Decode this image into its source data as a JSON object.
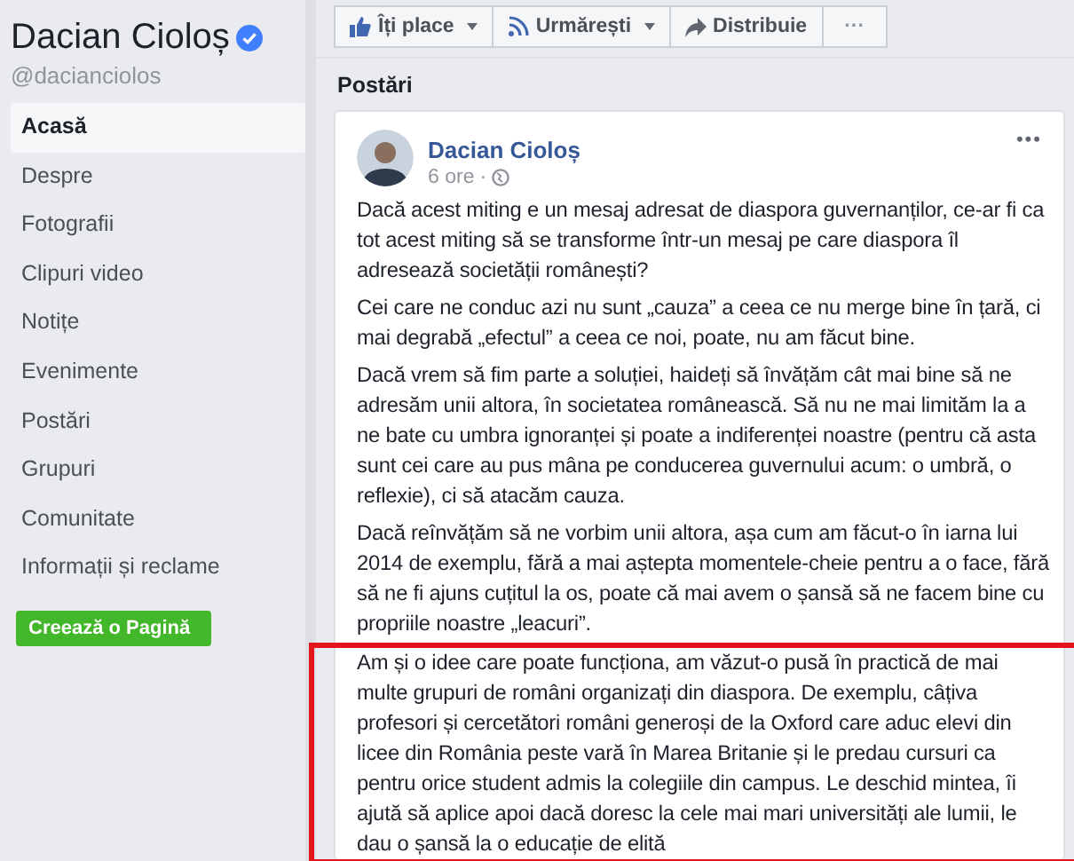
{
  "sidebar": {
    "page_name": "Dacian Cioloș",
    "verified": true,
    "handle": "@dacianciolos",
    "items": [
      {
        "label": "Acasă",
        "selected": true
      },
      {
        "label": "Despre",
        "selected": false
      },
      {
        "label": "Fotografii",
        "selected": false
      },
      {
        "label": "Clipuri video",
        "selected": false
      },
      {
        "label": "Notițe",
        "selected": false
      },
      {
        "label": "Evenimente",
        "selected": false
      },
      {
        "label": "Postări",
        "selected": false
      },
      {
        "label": "Grupuri",
        "selected": false
      },
      {
        "label": "Comunitate",
        "selected": false
      },
      {
        "label": "Informații și reclame",
        "selected": false
      }
    ],
    "create_button": "Creează o Pagină"
  },
  "actions": [
    {
      "kind": "like",
      "label": "Îți place",
      "dropdown": true
    },
    {
      "kind": "follow",
      "label": "Urmărești",
      "dropdown": true
    },
    {
      "kind": "share",
      "label": "Distribuie",
      "dropdown": false
    },
    {
      "kind": "more",
      "label": "···",
      "dropdown": false
    }
  ],
  "section_title": "Postări",
  "post": {
    "author": "Dacian Cioloș",
    "time": "6 ore",
    "separator": "·",
    "menu": "•••",
    "paragraphs": [
      {
        "text": "Dacă acest miting e un mesaj adresat de diaspora guvernanților, ce-ar fi ca tot acest miting să se transforme într-un mesaj pe care diaspora îl adresează societății românești?",
        "highlighted": false
      },
      {
        "text": "Cei care ne conduc azi nu sunt „cauza” a ceea ce nu merge bine în țară, ci mai degrabă „efectul” a ceea ce noi, poate, nu am făcut bine.",
        "highlighted": false
      },
      {
        "text": "Dacă vrem să fim parte a soluției, haideți să învățăm cât mai bine să ne adresăm unii altora, în societatea românească. Să nu ne mai limităm la a ne bate cu umbra ignoranței și poate a indiferenței noastre (pentru că asta sunt cei care au pus mâna pe conducerea guvernului acum: o umbră, o reflexie), ci să atacăm cauza.",
        "highlighted": false
      },
      {
        "text": "Dacă reînvățăm să ne vorbim unii altora, așa cum am făcut-o în iarna lui 2014 de exemplu, fără a mai aștepta momentele-cheie pentru a o face, fără să ne fi ajuns cuțitul la os, poate că mai avem o șansă să ne facem bine cu propriile noastre „leacuri”.",
        "highlighted": false
      },
      {
        "text": "Am și o idee care poate funcționa, am văzut-o pusă în practică de mai multe grupuri de români organizați din diaspora. De exemplu, câțiva profesori și cercetători români generoși de la Oxford care aduc elevi din licee din România peste vară în Marea Britanie și le predau cursuri ca pentru orice student admis la colegiile din campus. Le deschid mintea, îi ajută să aplice apoi dacă doresc la cele mai mari universități ale lumii, le dau o șansă la o educație de elită",
        "highlighted": true
      }
    ]
  }
}
